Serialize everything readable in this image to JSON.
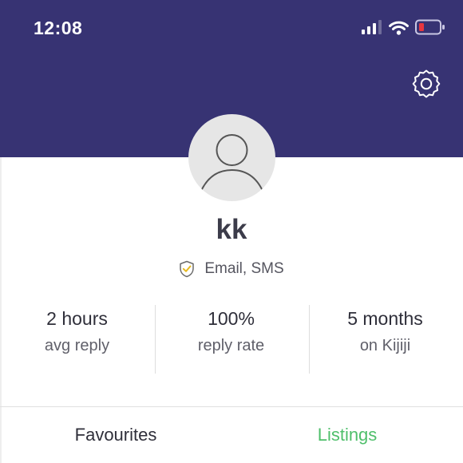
{
  "status_bar": {
    "time": "12:08",
    "icons": [
      "signal-icon",
      "wifi-icon",
      "battery-icon"
    ],
    "battery_color": "#e8373f"
  },
  "header": {
    "background": "#373373",
    "settings_icon": "gear-icon"
  },
  "profile": {
    "avatar_icon": "user-avatar-icon",
    "name": "kk",
    "verification_icon": "shield-check-icon",
    "verification_text": "Email, SMS"
  },
  "stats": [
    {
      "value": "2 hours",
      "label": "avg reply"
    },
    {
      "value": "100%",
      "label": "reply rate"
    },
    {
      "value": "5 months",
      "label": "on Kijiji"
    }
  ],
  "tabs": [
    {
      "label": "Favourites",
      "active": false
    },
    {
      "label": "Listings",
      "active": true,
      "color": "#4fbf6b"
    }
  ]
}
